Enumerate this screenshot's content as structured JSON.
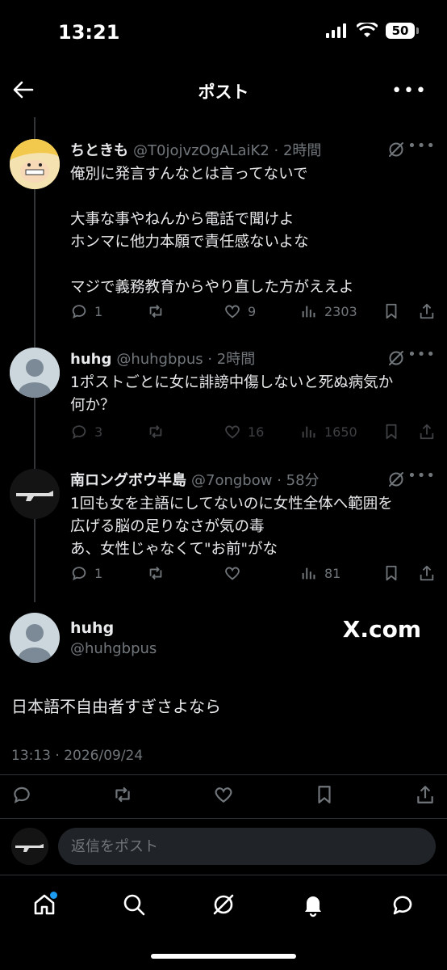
{
  "status_bar": {
    "time": "13:21",
    "battery": "50"
  },
  "header": {
    "title": "ポスト",
    "back_icon": "arrow-left-icon",
    "more_icon": "more-horizontal-icon"
  },
  "replies": [
    {
      "name": "ちときも",
      "handle": "@T0jojvzOgALaiK2",
      "time": "2時間",
      "text": "俺別に発言すんなとは言ってないで\n\n大事な事やねんから電話で聞けよ\nホンマに他力本願で責任感ないよな\n\nマジで義務教育からやり直した方がええよ",
      "replies": "1",
      "reposts": "",
      "likes": "9",
      "views": "2303"
    },
    {
      "name": "huhg",
      "handle": "@huhgbpus",
      "time": "2時間",
      "text": "1ポストごとに女に誹謗中傷しないと死ぬ病気か\n何か？",
      "replies": "3",
      "reposts": "",
      "likes": "16",
      "views": "1650"
    },
    {
      "name": "南ロングボウ半島",
      "handle": "@7ongbow",
      "time": "58分",
      "text": "1回も女を主語にしてないのに女性全体へ範囲を\n広げる脳の足りなさが気の毒\nあ、女性じゃなくて\"お前\"がな",
      "replies": "1",
      "reposts": "",
      "likes": "",
      "views": "81"
    }
  ],
  "main_post": {
    "name": "huhg",
    "handle": "@huhgbpus",
    "watermark": "X.com",
    "text": "日本語不自由者すぎさよなら",
    "timestamp": "13:13 · 2026/09/24"
  },
  "reply_bar": {
    "placeholder": "返信をポスト"
  },
  "nav": [
    "home-icon",
    "search-icon",
    "grok-icon",
    "notifications-icon",
    "messages-icon"
  ],
  "colors": {
    "background": "#000000",
    "text": "#e7e9ea",
    "muted": "#71767b",
    "accent": "#1d9bf0"
  }
}
